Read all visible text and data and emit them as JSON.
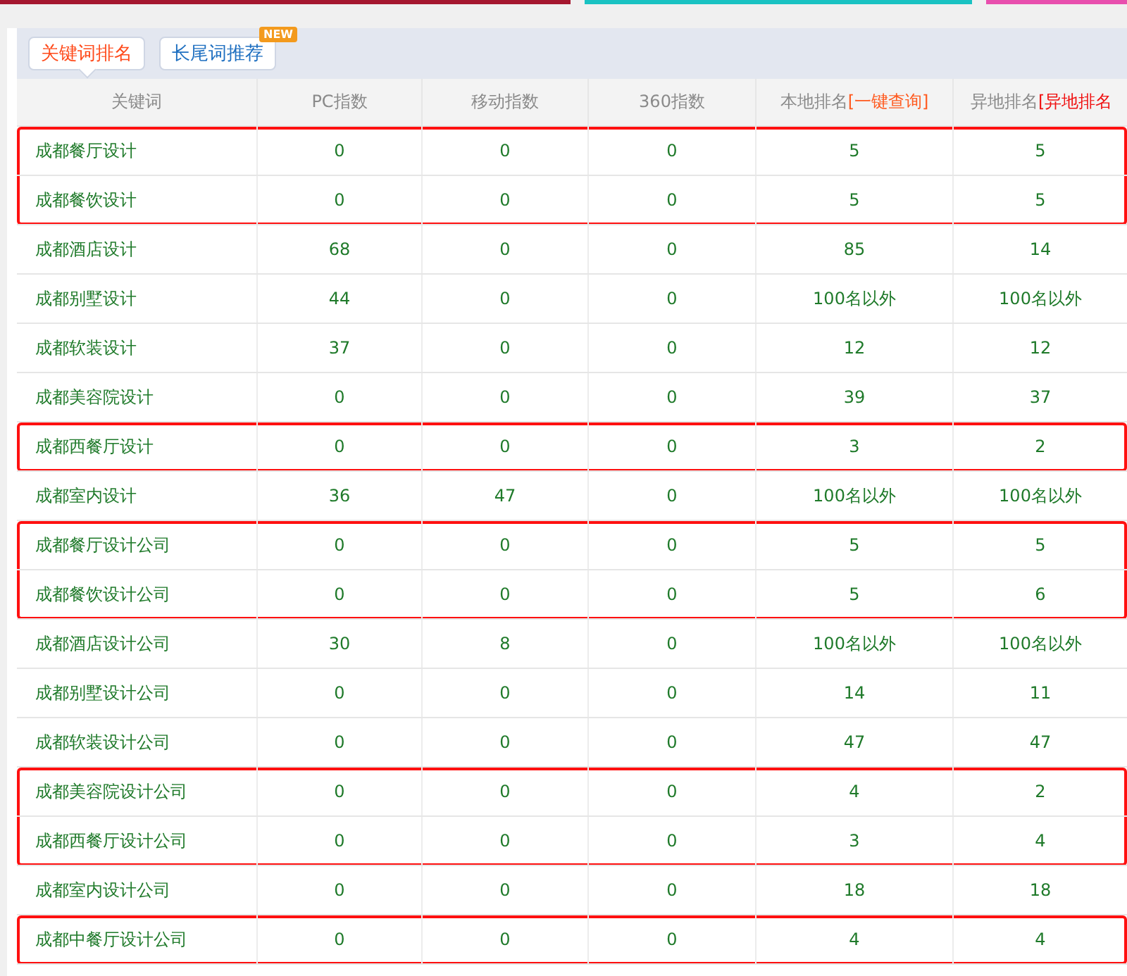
{
  "tabs": [
    {
      "label": "关键词排名",
      "selected": true
    },
    {
      "label": "长尾词推荐",
      "selected": false,
      "badge": "NEW"
    }
  ],
  "table": {
    "columns": [
      {
        "label": "关键词"
      },
      {
        "label": "PC指数"
      },
      {
        "label": "移动指数"
      },
      {
        "label": "360指数"
      },
      {
        "label": "本地排名",
        "link": "[一键查询]"
      },
      {
        "label": "异地排名",
        "link": "[异地排名"
      }
    ],
    "row_groups": [
      {
        "highlighted": true,
        "rows": [
          [
            "成都餐厅设计",
            "0",
            "0",
            "0",
            "5",
            "5"
          ],
          [
            "成都餐饮设计",
            "0",
            "0",
            "0",
            "5",
            "5"
          ]
        ]
      },
      {
        "highlighted": false,
        "rows": [
          [
            "成都酒店设计",
            "68",
            "0",
            "0",
            "85",
            "14"
          ],
          [
            "成都别墅设计",
            "44",
            "0",
            "0",
            "100名以外",
            "100名以外"
          ],
          [
            "成都软装设计",
            "37",
            "0",
            "0",
            "12",
            "12"
          ],
          [
            "成都美容院设计",
            "0",
            "0",
            "0",
            "39",
            "37"
          ]
        ]
      },
      {
        "highlighted": true,
        "rows": [
          [
            "成都西餐厅设计",
            "0",
            "0",
            "0",
            "3",
            "2"
          ]
        ]
      },
      {
        "highlighted": false,
        "rows": [
          [
            "成都室内设计",
            "36",
            "47",
            "0",
            "100名以外",
            "100名以外"
          ]
        ]
      },
      {
        "highlighted": true,
        "rows": [
          [
            "成都餐厅设计公司",
            "0",
            "0",
            "0",
            "5",
            "5"
          ],
          [
            "成都餐饮设计公司",
            "0",
            "0",
            "0",
            "5",
            "6"
          ]
        ]
      },
      {
        "highlighted": false,
        "rows": [
          [
            "成都酒店设计公司",
            "30",
            "8",
            "0",
            "100名以外",
            "100名以外"
          ],
          [
            "成都别墅设计公司",
            "0",
            "0",
            "0",
            "14",
            "11"
          ],
          [
            "成都软装设计公司",
            "0",
            "0",
            "0",
            "47",
            "47"
          ]
        ]
      },
      {
        "highlighted": true,
        "rows": [
          [
            "成都美容院设计公司",
            "0",
            "0",
            "0",
            "4",
            "2"
          ],
          [
            "成都西餐厅设计公司",
            "0",
            "0",
            "0",
            "3",
            "4"
          ]
        ]
      },
      {
        "highlighted": false,
        "rows": [
          [
            "成都室内设计公司",
            "0",
            "0",
            "0",
            "18",
            "18"
          ]
        ]
      },
      {
        "highlighted": true,
        "rows": [
          [
            "成都中餐厅设计公司",
            "0",
            "0",
            "0",
            "4",
            "4"
          ]
        ]
      }
    ]
  }
}
